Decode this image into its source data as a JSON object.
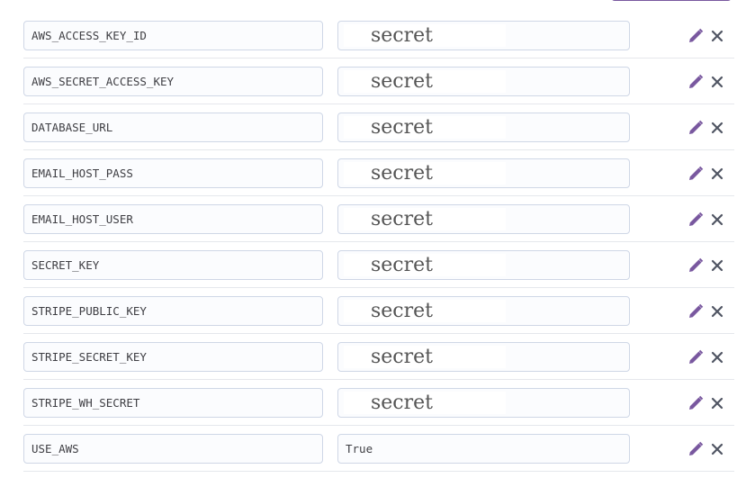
{
  "colors": {
    "accent": "#79589f",
    "field_border": "#cfd7e6",
    "row_divider": "#e5e7ec",
    "remove_icon": "#505563"
  },
  "icons": {
    "edit": "pencil-icon",
    "remove": "close-icon"
  },
  "config_vars": [
    {
      "key": "AWS_ACCESS_KEY_ID",
      "value": "secret",
      "masked": true
    },
    {
      "key": "AWS_SECRET_ACCESS_KEY",
      "value": "secret",
      "masked": true
    },
    {
      "key": "DATABASE_URL",
      "value": "secret",
      "masked": true
    },
    {
      "key": "EMAIL_HOST_PASS",
      "value": "secret",
      "masked": true
    },
    {
      "key": "EMAIL_HOST_USER",
      "value": "secret",
      "masked": true
    },
    {
      "key": "SECRET_KEY",
      "value": "secret",
      "masked": true
    },
    {
      "key": "STRIPE_PUBLIC_KEY",
      "value": "secret",
      "masked": true
    },
    {
      "key": "STRIPE_SECRET_KEY",
      "value": "secret",
      "masked": true
    },
    {
      "key": "STRIPE_WH_SECRET",
      "value": "secret",
      "masked": true
    },
    {
      "key": "USE_AWS",
      "value": "True",
      "masked": false
    }
  ]
}
